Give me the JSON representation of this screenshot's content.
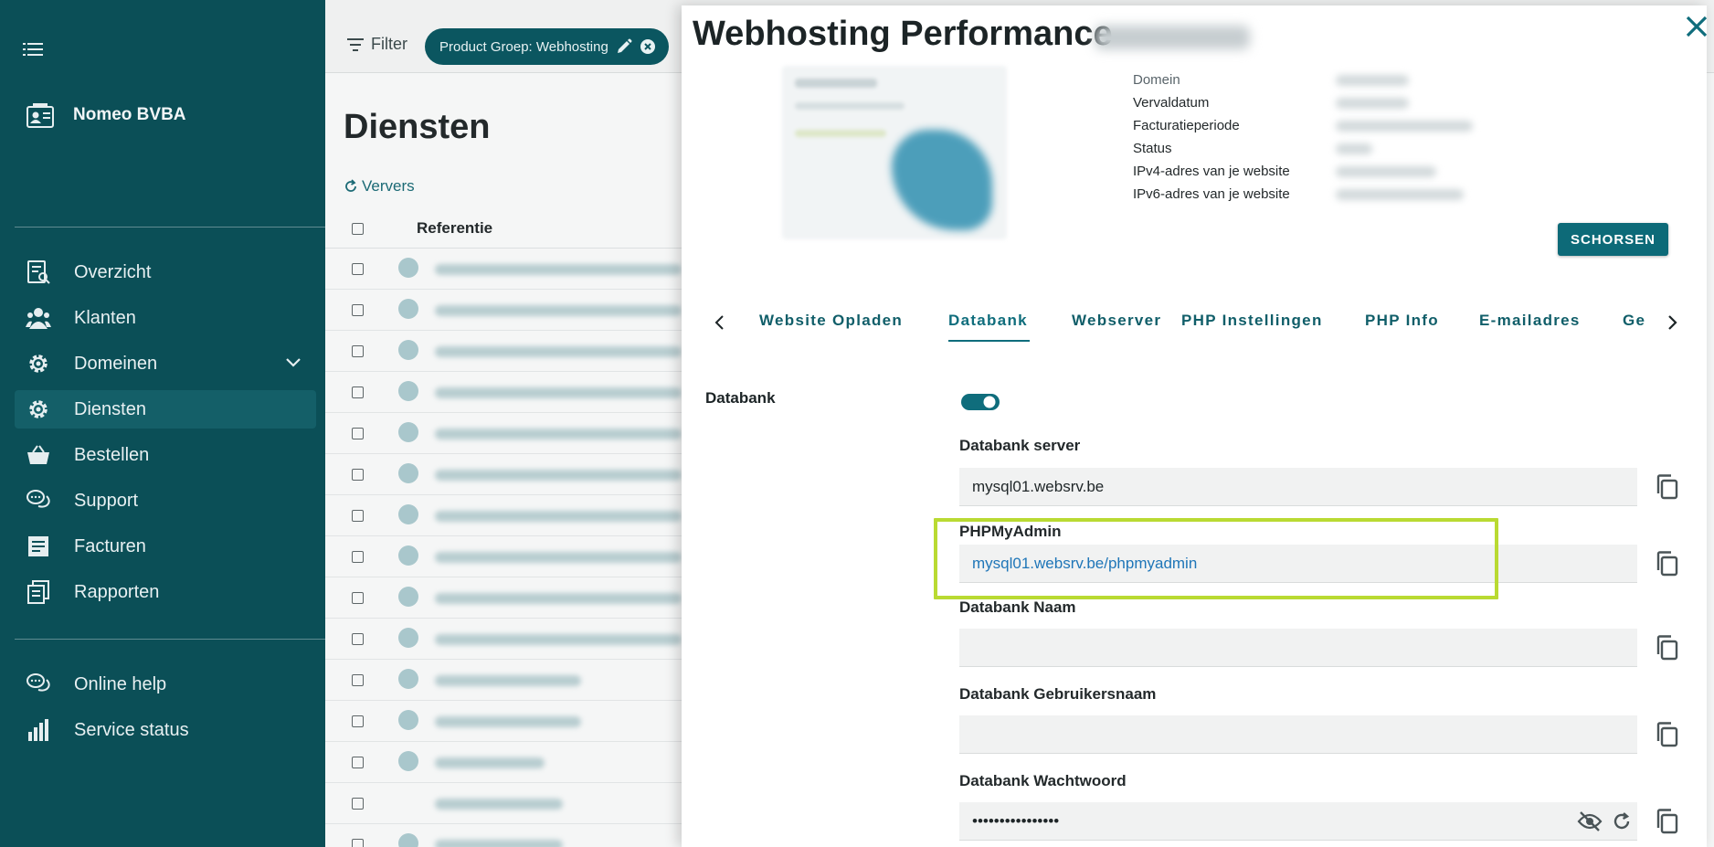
{
  "sidebar": {
    "company_name": "Nomeo BVBA",
    "items": [
      {
        "label": "Overzicht",
        "icon": "overview-icon"
      },
      {
        "label": "Klanten",
        "icon": "users-icon"
      },
      {
        "label": "Domeinen",
        "icon": "gear-icon"
      },
      {
        "label": "Diensten",
        "icon": "gear-icon",
        "active": true
      },
      {
        "label": "Bestellen",
        "icon": "basket-icon"
      },
      {
        "label": "Support",
        "icon": "chat-icon"
      },
      {
        "label": "Facturen",
        "icon": "invoice-icon"
      },
      {
        "label": "Rapporten",
        "icon": "reports-icon"
      }
    ],
    "bottom_items": [
      {
        "label": "Online help",
        "icon": "chat-icon"
      },
      {
        "label": "Service status",
        "icon": "bar-chart-icon"
      }
    ]
  },
  "background": {
    "filter_label": "Filter",
    "chip_label": "Product Groep: Webhosting",
    "page_title": "Diensten",
    "refresh_label": "Ververs",
    "column_header": "Referentie"
  },
  "panel": {
    "title": "Webhosting Performance",
    "info_labels": [
      "Domein",
      "Vervaldatum",
      "Facturatieperiode",
      "Status",
      "IPv4-adres van je website",
      "IPv6-adres van je website"
    ],
    "suspend_label": "SCHORSEN",
    "tabs": [
      "Website Opladen",
      "Databank",
      "Webserver",
      "PHP Instellingen",
      "PHP Info",
      "E-mailadres",
      "Ge"
    ],
    "active_tab": "Databank",
    "section_label": "Databank",
    "toggle_on": true,
    "fields": {
      "server_label": "Databank server",
      "server_value": "mysql01.websrv.be",
      "phpmyadmin_label": "PHPMyAdmin",
      "phpmyadmin_value": "mysql01.websrv.be/phpmyadmin",
      "name_label": "Databank Naam",
      "name_value": "",
      "user_label": "Databank Gebruikersnaam",
      "user_value": "",
      "password_label": "Databank Wachtwoord",
      "password_value": "••••••••••••••••"
    }
  },
  "colors": {
    "sidebar_bg": "#0b4f57",
    "accent": "#0f6d7c",
    "highlight": "#b9da32",
    "link": "#1f76b8"
  }
}
